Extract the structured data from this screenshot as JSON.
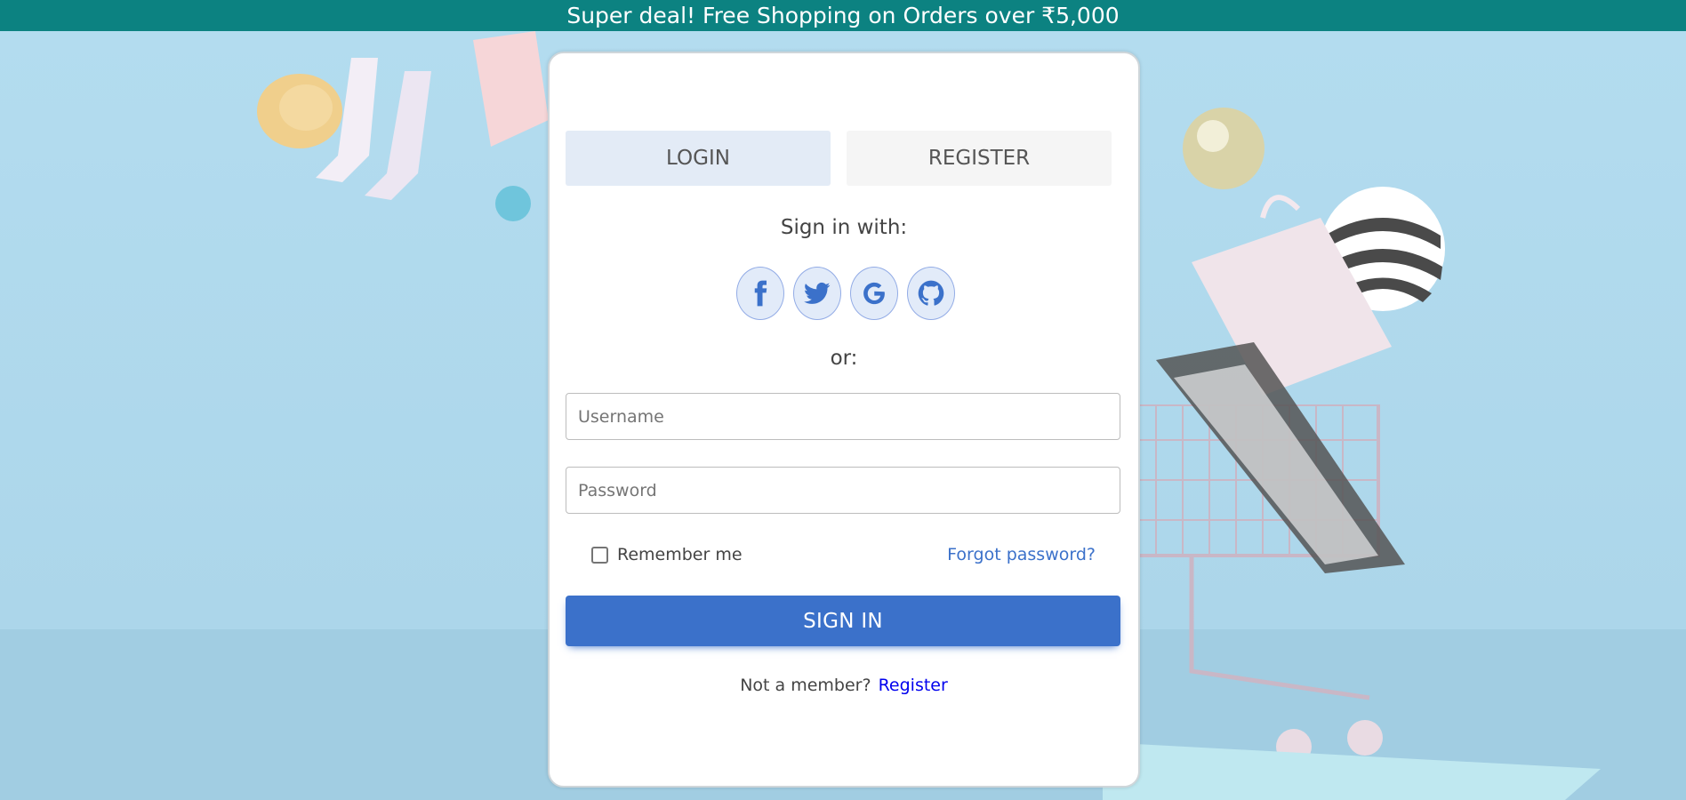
{
  "banner": {
    "text": "Super deal! Free Shopping on Orders over ₹5,000"
  },
  "tabs": {
    "login": "LOGIN",
    "register": "REGISTER"
  },
  "social": {
    "heading": "Sign in with:",
    "buttons": [
      "facebook-icon",
      "twitter-icon",
      "google-icon",
      "github-icon"
    ]
  },
  "or_label": "or:",
  "form": {
    "username_placeholder": "Username",
    "username_value": "",
    "password_placeholder": "Password",
    "password_value": "",
    "remember_label": "Remember me",
    "remember_checked": false,
    "forgot_label": "Forgot password?",
    "submit_label": "SIGN IN"
  },
  "footer": {
    "prompt": "Not a member?",
    "register_link": "Register"
  },
  "colors": {
    "banner": "#0c8281",
    "primary": "#3b71ca",
    "background": "#add8ea"
  }
}
